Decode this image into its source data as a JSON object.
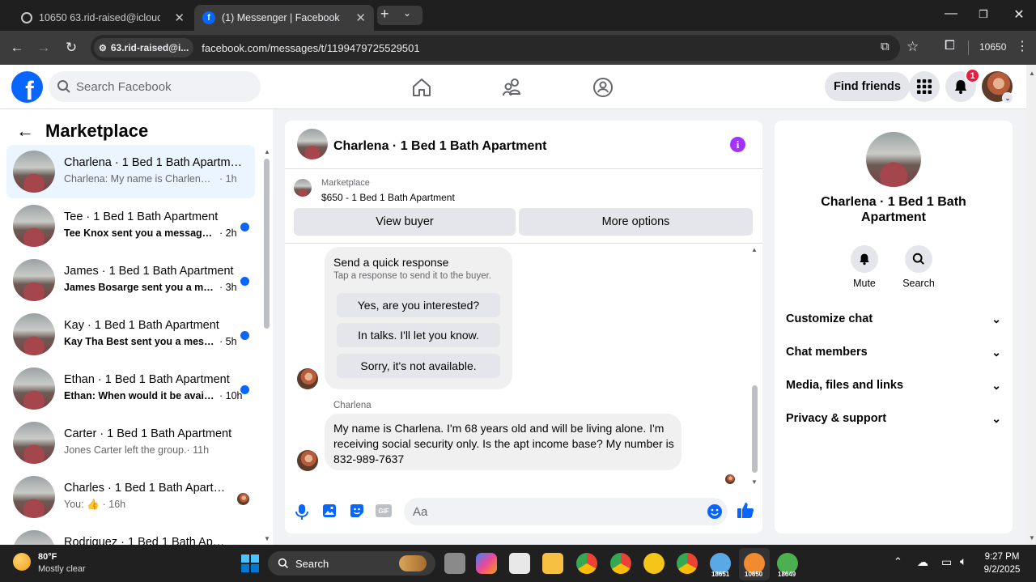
{
  "browser": {
    "tabs": [
      {
        "title": "10650 63.rid-raised@icloud.com"
      },
      {
        "title": "(1) Messenger | Facebook"
      }
    ],
    "site_chip": "63.rid-raised@i...",
    "url": "facebook.com/messages/t/1199479725529501",
    "profile_label": "10650"
  },
  "fb_header": {
    "logo": "f",
    "search_placeholder": "Search Facebook",
    "find_friends": "Find friends",
    "notification_count": "1"
  },
  "left_pane": {
    "title": "Marketplace",
    "conversations": [
      {
        "name": "Charlena · 1 Bed 1 Bath Apartment",
        "preview": "Charlena: My name is Charlena. I'm ...",
        "time": "· 1h",
        "selected": true,
        "unread": false
      },
      {
        "name": "Tee · 1 Bed 1 Bath Apartment",
        "preview": "Tee Knox sent you a message ab...",
        "time": "· 2h",
        "unread": true
      },
      {
        "name": "James · 1 Bed 1 Bath Apartment",
        "preview": "James Bosarge sent you a mess...",
        "time": "· 3h",
        "unread": true
      },
      {
        "name": "Kay · 1 Bed 1 Bath Apartment",
        "preview": "Kay Tha Best sent you a messag...",
        "time": "· 5h",
        "unread": true
      },
      {
        "name": "Ethan · 1 Bed 1 Bath Apartment",
        "preview": "Ethan: When would it be availa...",
        "time": "· 10h",
        "unread": true
      },
      {
        "name": "Carter · 1 Bed 1 Bath Apartment",
        "preview": "Jones Carter left the group.",
        "time": "· 11h",
        "unread": false
      },
      {
        "name": "Charles · 1 Bed 1 Bath Apartm...",
        "preview": "You: 👍",
        "time": "· 16h",
        "unread": false
      },
      {
        "name": "Rodriguez · 1 Bed 1 Bath Apartm...",
        "preview": "",
        "time": "",
        "unread": false
      }
    ]
  },
  "chat": {
    "title": "Charlena · 1 Bed 1 Bath Apartment",
    "listing_source": "Marketplace",
    "listing": "$650 - 1 Bed 1 Bath Apartment",
    "view_buyer": "View buyer",
    "more_options": "More options",
    "quick_response": {
      "title": "Send a quick response",
      "subtitle": "Tap a response to send it to the buyer.",
      "options": [
        "Yes, are you interested?",
        "In talks. I'll let you know.",
        "Sorry, it's not available."
      ]
    },
    "sender": "Charlena",
    "message": {
      "line1": "My name is Charlena. I'm 68 years old and will be living alone. I'm",
      "line2": "receiving social security only. Is the apt income base? My number is",
      "line3": "832-989-7637"
    },
    "input_placeholder": "Aa"
  },
  "right_pane": {
    "name_line1": "Charlena · 1 Bed 1 Bath",
    "name_line2": "Apartment",
    "mute": "Mute",
    "search": "Search",
    "sections": [
      "Customize chat",
      "Chat members",
      "Media, files and links",
      "Privacy & support"
    ]
  },
  "taskbar": {
    "temperature": "80°F",
    "weather": "Mostly clear",
    "search": "Search",
    "time": "9:27 PM",
    "date": "9/2/2025",
    "app_labels": [
      "18651",
      "10650",
      "18649"
    ]
  },
  "colors": {
    "brand": "#0866ff",
    "unread_dot": "#0866ff",
    "info_purple": "#a033ff",
    "notification_red": "#e41e3f"
  }
}
